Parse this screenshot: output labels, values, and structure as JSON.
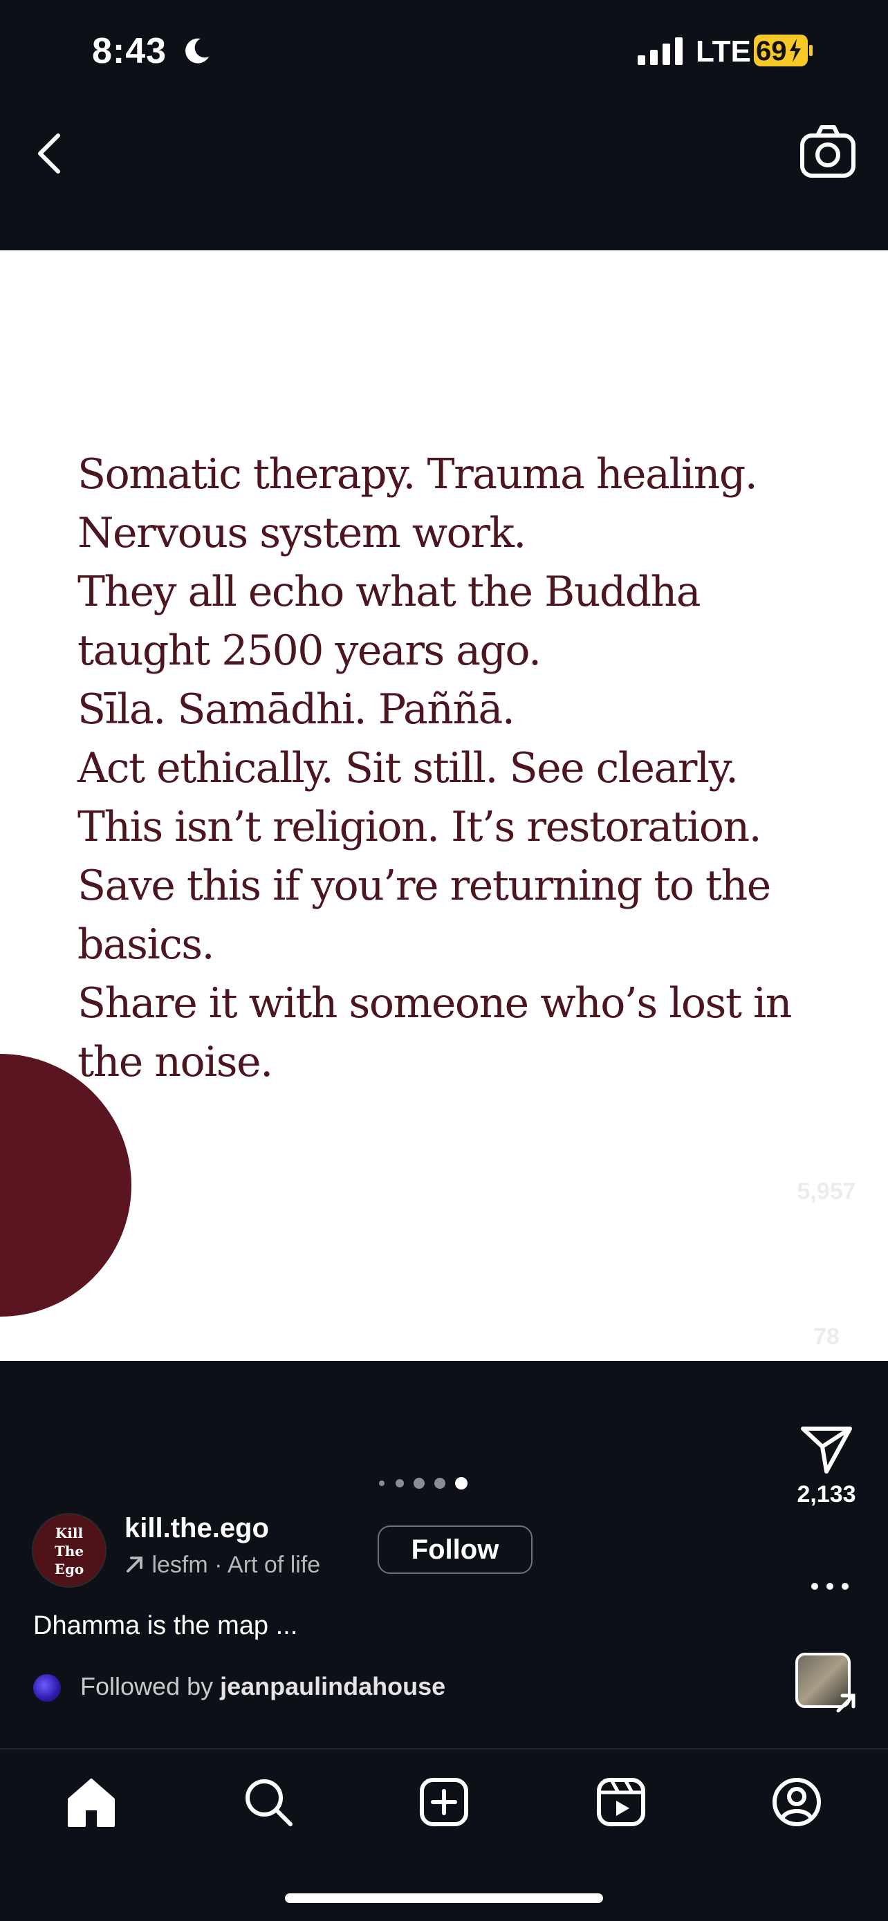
{
  "status_bar": {
    "time": "8:43",
    "network": "LTE",
    "battery": "69"
  },
  "post": {
    "lines": [
      "Somatic therapy. Trauma healing.",
      "Nervous system work.",
      "They all echo what the Buddha",
      "taught 2500 years ago.",
      "Sīla. Samādhi. Paññā.",
      "Act ethically. Sit still. See clearly.",
      "This isn’t religion. It’s restoration.",
      "Save this if you’re returning to the",
      "basics.",
      "Share it with someone who’s lost in",
      "the noise."
    ],
    "text_color": "#4b1620",
    "accent_circle_color": "#5a1520"
  },
  "actions": {
    "likes": "5,957",
    "comments": "78",
    "shares": "2,133"
  },
  "account": {
    "avatar_text": [
      "Kill",
      "The",
      "Ego"
    ],
    "username": "kill.the.ego",
    "music": "lesfm · Art of life",
    "follow_label": "Follow"
  },
  "caption": "Dhamma is the map ...",
  "followed_by": {
    "prefix": "Followed by",
    "name": "jeanpaulindahouse"
  },
  "carousel": {
    "total": 5,
    "active": 5
  },
  "icons": {
    "back": "chevron-left-icon",
    "camera": "camera-icon",
    "like": "heart-icon",
    "comment": "comment-icon",
    "share": "send-icon",
    "more": "more-icon",
    "tabs": [
      "home-icon",
      "search-icon",
      "create-icon",
      "reels-icon",
      "profile-icon"
    ]
  }
}
